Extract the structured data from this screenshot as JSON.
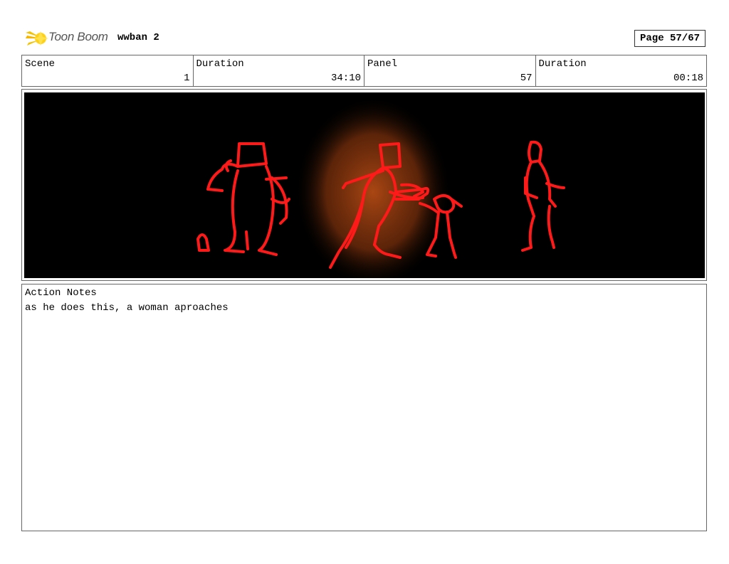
{
  "header": {
    "logo_text": "Toon Boom",
    "project": "wwban 2",
    "page": "Page 57/67"
  },
  "info": {
    "scene": {
      "label": "Scene",
      "value": "1"
    },
    "duration_total": {
      "label": "Duration",
      "value": "34:10"
    },
    "panel": {
      "label": "Panel",
      "value": "57"
    },
    "duration_panel": {
      "label": "Duration",
      "value": "00:18"
    }
  },
  "notes": {
    "label": "Action Notes",
    "text": "as he does this, a woman aproaches"
  },
  "colors": {
    "sketch": "#ff1a1a",
    "glow": "#b34a14",
    "background": "#000000"
  }
}
